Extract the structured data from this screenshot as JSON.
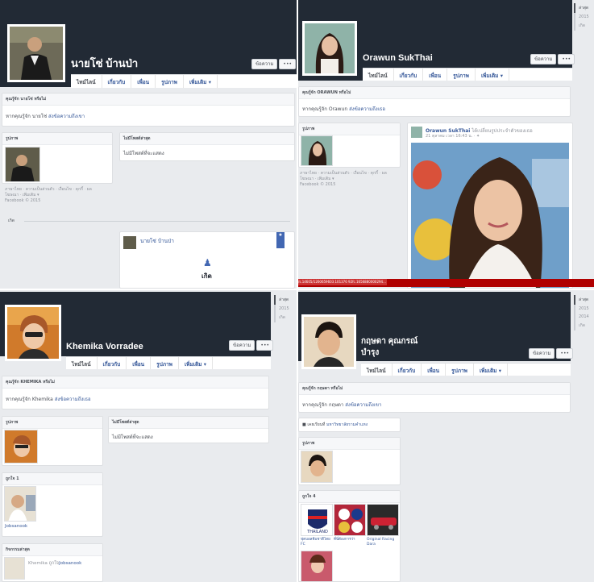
{
  "p1": {
    "name": "นายโซ่ บ้านป่า",
    "message_btn": "ข้อความ",
    "more_btn": "•••",
    "tabs": [
      "ไทม์ไลน์",
      "เกี่ยวกับ",
      "เพื่อน",
      "รูปภาพ",
      "เพิ่มเติม ▾"
    ],
    "know_header": "คุณรู้จัก นายโซ่ หรือไม่",
    "know_text": "หากคุณรู้จัก นายโซ่",
    "know_link": "ส่งข้อความถึงเขา",
    "photos_header": "รูปภาพ",
    "recent_header": "ไม่มีโพสต์ล่าสุด",
    "recent_text": "ไม่มีโพสต์ที่จะแสดง",
    "footer": [
      "ภาษาไทย · ความเป็นส่วนตัว · เงื่อนไข · คุกกี้ · ผล",
      "โฆษณา · เพิ่มเติม ▾",
      "Facebook © 2015"
    ],
    "born_label": "เกิด",
    "post_name": "นายโซ่ บ้านป่า",
    "post_born": "เกิด"
  },
  "p2": {
    "name": "Orawun SukThai",
    "message_btn": "ข้อความ",
    "more_btn": "•••",
    "tabs": [
      "ไทม์ไลน์",
      "เกี่ยวกับ",
      "เพื่อน",
      "รูปภาพ",
      "เพิ่มเติม ▾"
    ],
    "know_header": "คุณรู้จัก ORAWUN หรือไม่",
    "know_text": "หากคุณรู้จัก Orawun",
    "know_link": "ส่งข้อความถึงเธอ",
    "photos_header": "รูปภาพ",
    "footer": [
      "ภาษาไทย · ความเป็นส่วนตัว · เงื่อนไข · คุกกี้ · ผล",
      "โฆษณา · เพิ่มเติม ▾",
      "Facebook © 2015"
    ],
    "post_author": "Orawun SukThai",
    "post_action": "ได้เปลี่ยนรูปประจำตัวของเธอ",
    "post_time": "21 ตุลาคม เวลา 16:43 น. · ✦",
    "year_nav": [
      "ล่าสุด",
      "2015",
      "เกิด"
    ],
    "url_text": "/s.14605/1260659603.101376 92fc.1656880000294..."
  },
  "p3": {
    "name": "Khemika Vorradee",
    "message_btn": "ข้อความ",
    "more_btn": "•••",
    "tabs": [
      "ไทม์ไลน์",
      "เกี่ยวกับ",
      "เพื่อน",
      "รูปภาพ",
      "เพิ่มเติม ▾"
    ],
    "know_header": "คุณรู้จัก KHEMIKA หรือไม่",
    "know_text": "หากคุณรู้จัก Khemika",
    "know_link": "ส่งข้อความถึงเธอ",
    "photos_header": "รูปภาพ",
    "recent_header": "ไม่มีโพสต์ล่าสุด",
    "recent_text": "ไม่มีโพสต์ที่จะแสดง",
    "likes_header": "ถูกใจ   1",
    "likes_item": "Jobsanook",
    "activity_header": "กิจกรรมล่าสุด",
    "activity_text": "Khemika ถูกใจ",
    "activity_link": "Jobsanook",
    "year_nav": [
      "ล่าสุด",
      "2015",
      "เกิด"
    ]
  },
  "p4": {
    "name_line1": "กฤษดา คุณกรณ์",
    "name_line2": "บำรุง",
    "message_btn": "ข้อความ",
    "more_btn": "•••",
    "tabs": [
      "ไทม์ไลน์",
      "เกี่ยวกับ",
      "เพื่อน",
      "รูปภาพ",
      "เพิ่มเติม ▾"
    ],
    "know_header": "คุณรู้จัก กฤษดา หรือไม่",
    "know_text": "หากคุณรู้จัก กฤษดา",
    "know_link": "ส่งข้อความถึงเขา",
    "edu_prefix": "■ ",
    "edu_text": "เคยเรียนที่",
    "edu_link": "มหาวิทยาลัยรามคำแหง",
    "photos_header": "รูปภาพ",
    "likes_header": "ถูกใจ   4",
    "likes": [
      "ฟุตบอลทีมชาติไทย FC",
      "ที่นี่ต้องการว่า",
      "Original Racing Dara"
    ],
    "year_nav": [
      "ล่าสุด",
      "2015",
      "2014",
      "เกิด"
    ]
  },
  "colors": {
    "cover": "#222a35",
    "link": "#365899",
    "accent": "#b00000"
  }
}
